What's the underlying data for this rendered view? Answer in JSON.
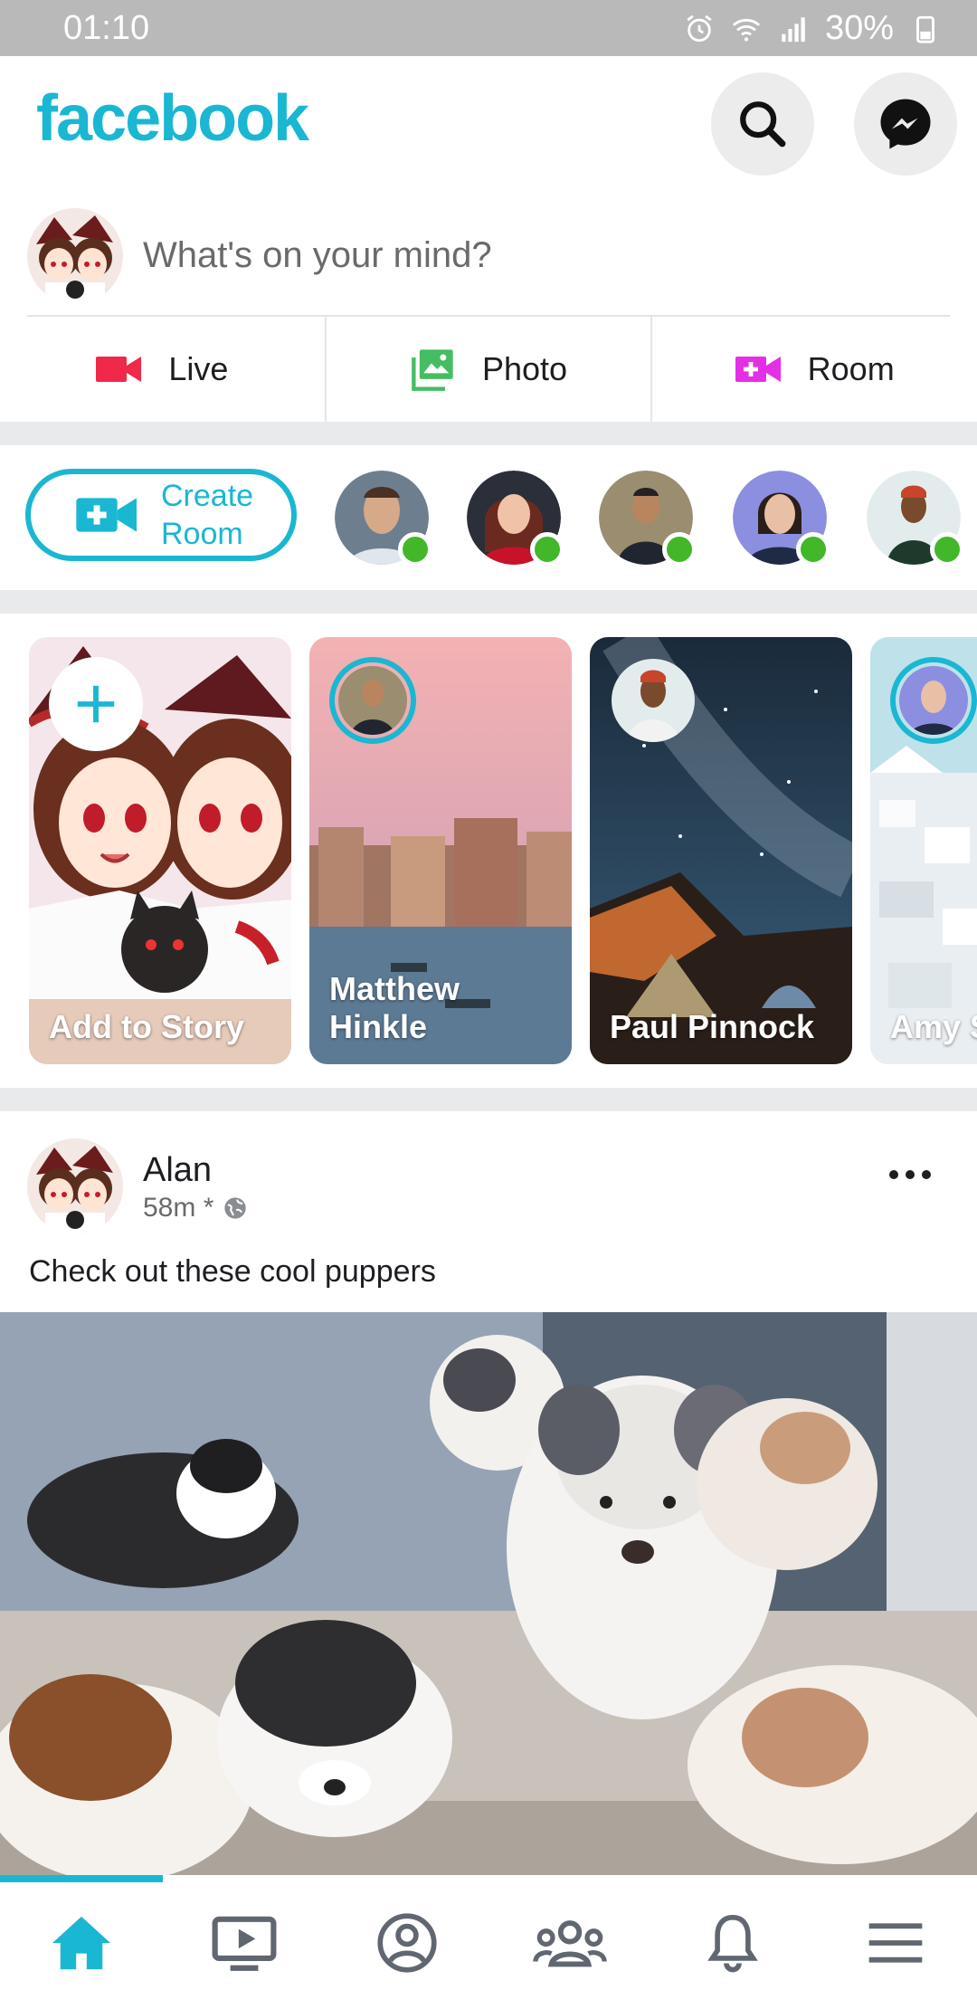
{
  "status_bar": {
    "time": "01:10",
    "battery": "30%"
  },
  "header": {
    "logo": "facebook",
    "icons": [
      "search-icon",
      "messenger-icon"
    ]
  },
  "composer": {
    "placeholder": "What's on your mind?"
  },
  "actions": [
    {
      "label": "Live",
      "icon": "video-camera-icon",
      "color": "#f02849"
    },
    {
      "label": "Photo",
      "icon": "photo-icon",
      "color": "#45bd62"
    },
    {
      "label": "Room",
      "icon": "room-icon",
      "color": "#e42fe6"
    }
  ],
  "rooms": {
    "create_label_line1": "Create",
    "create_label_line2": "Room",
    "friends_online": 5
  },
  "stories": [
    {
      "name_line1": "Add to Story",
      "name_line2": ""
    },
    {
      "name_line1": "Matthew",
      "name_line2": "Hinkle"
    },
    {
      "name_line1": "Paul Pinnock",
      "name_line2": ""
    },
    {
      "name_line1": "Amy S",
      "name_line2": ""
    }
  ],
  "post": {
    "author": "Alan",
    "time": "58m *",
    "text": "Check out these cool puppers"
  },
  "bottom_nav": [
    "home-icon",
    "watch-icon",
    "profile-icon",
    "groups-icon",
    "notifications-icon",
    "menu-icon"
  ],
  "colors": {
    "accent": "#1ab7d2",
    "online": "#42b72a"
  }
}
